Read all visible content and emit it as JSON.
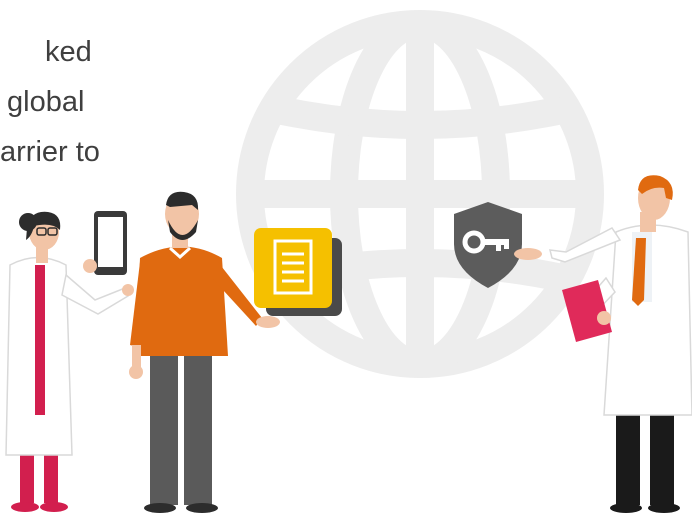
{
  "hero": {
    "text_lines": [
      "ked",
      "global",
      "arrier to"
    ]
  },
  "illustration": {
    "icons": [
      "globe-icon",
      "document-icon",
      "shield-key-icon",
      "tablet-icon",
      "clipboard-icon"
    ],
    "colors": {
      "globe": "#ededed",
      "document_front": "#f5c000",
      "document_back": "#4a4a4a",
      "shield": "#5c5c5c",
      "sweater": "#e06a10",
      "pants": "#5a5a5a",
      "skin": "#f2c4a6",
      "hair": "#2c2c2c",
      "lab_coat": "#ffffff",
      "accent_red": "#d21f4e",
      "tie": "#e06a10"
    }
  }
}
